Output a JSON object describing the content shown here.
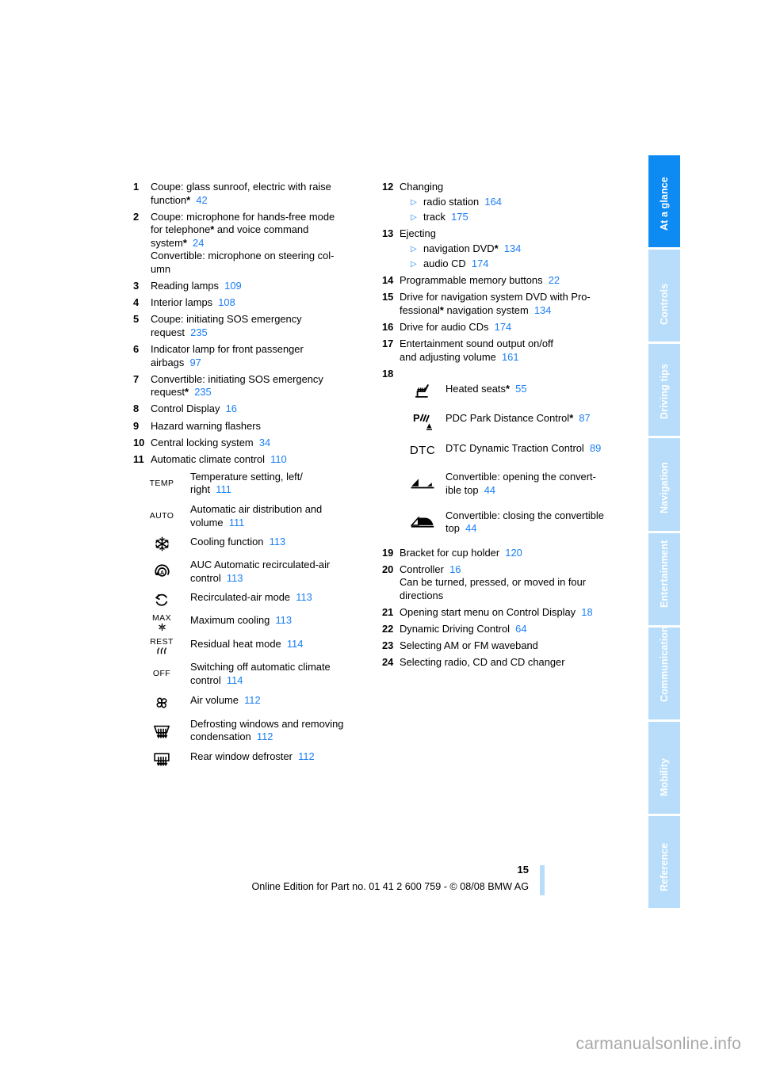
{
  "page": {
    "number": "15",
    "footer_text": "Online Edition for Part no. 01 41 2 600 759 - © 08/08 BMW AG",
    "watermark": "carmanualsonline.info"
  },
  "colors": {
    "reference_blue": "#1a7ef5",
    "tab_active": "#0d8bf2",
    "tab_inactive": "#b7ddfb",
    "watermark_gray": "#a8a8a8"
  },
  "sidebar": {
    "tabs": [
      {
        "label": "At a glance",
        "active": true
      },
      {
        "label": "Controls",
        "active": false
      },
      {
        "label": "Driving tips",
        "active": false
      },
      {
        "label": "Navigation",
        "active": false
      },
      {
        "label": "Entertainment",
        "active": false
      },
      {
        "label": "Communications",
        "active": false
      },
      {
        "label": "Mobility",
        "active": false
      },
      {
        "label": "Reference",
        "active": false
      }
    ]
  },
  "left_column": {
    "item1": {
      "num": "1",
      "line1": "Coupe: glass sunroof, electric with raise",
      "line2": "function",
      "star": "*",
      "ref": "42"
    },
    "item2": {
      "num": "2",
      "line1": "Coupe: microphone for hands-free mode",
      "line2a": "for telephone",
      "star1": "*",
      "line2b": " and voice command",
      "line3": "system",
      "star2": "*",
      "ref": "24",
      "line4": "Convertible: microphone on steering col-",
      "line5": "umn"
    },
    "item3": {
      "num": "3",
      "text": "Reading lamps",
      "ref": "109"
    },
    "item4": {
      "num": "4",
      "text": "Interior lamps",
      "ref": "108"
    },
    "item5": {
      "num": "5",
      "line1": "Coupe: initiating SOS emergency",
      "line2": "request",
      "ref": "235"
    },
    "item6": {
      "num": "6",
      "line1": "Indicator lamp for front passenger",
      "line2": "airbags",
      "ref": "97"
    },
    "item7": {
      "num": "7",
      "line1": "Convertible: initiating SOS emergency",
      "line2": "request",
      "star": "*",
      "ref": "235"
    },
    "item8": {
      "num": "8",
      "text": "Control Display",
      "ref": "16"
    },
    "item9": {
      "num": "9",
      "text": "Hazard warning flashers"
    },
    "item10": {
      "num": "10",
      "text": "Central locking system",
      "ref": "34"
    },
    "item11": {
      "num": "11",
      "text": "Automatic climate control",
      "ref": "110",
      "icon_rows": [
        {
          "icon": "temp-text-icon",
          "icon_label": "TEMP",
          "line1": "Temperature setting, left/",
          "line2": "right",
          "ref": "111"
        },
        {
          "icon": "auto-text-icon",
          "icon_label": "AUTO",
          "line1": "Automatic air distribution and",
          "line2": "volume",
          "ref": "111"
        },
        {
          "icon": "snowflake-icon",
          "line1": "Cooling function",
          "ref": "113"
        },
        {
          "icon": "auc-recirculation-icon",
          "line1": "AUC Automatic recirculated-air",
          "line2": "control",
          "ref": "113"
        },
        {
          "icon": "recirculated-air-icon",
          "line1": "Recirculated-air mode",
          "ref": "113"
        },
        {
          "icon": "max-cooling-icon",
          "icon_label": "MAX",
          "line1": "Maximum cooling",
          "ref": "113"
        },
        {
          "icon": "residual-heat-icon",
          "icon_label": "REST",
          "line1": "Residual heat mode",
          "ref": "114"
        },
        {
          "icon": "off-text-icon",
          "icon_label": "OFF",
          "line1": "Switching off automatic climate",
          "line2": "control",
          "ref": "114"
        },
        {
          "icon": "fan-air-volume-icon",
          "line1": "Air volume",
          "ref": "112"
        },
        {
          "icon": "windshield-defroster-icon",
          "line1": "Defrosting windows and removing",
          "line2": "condensation",
          "ref": "112"
        },
        {
          "icon": "rear-window-defroster-icon",
          "line1": "Rear window defroster",
          "ref": "112"
        }
      ]
    }
  },
  "right_column": {
    "item12": {
      "num": "12",
      "text": "Changing",
      "subs": [
        {
          "text": "radio station",
          "ref": "164"
        },
        {
          "text": "track",
          "ref": "175"
        }
      ]
    },
    "item13": {
      "num": "13",
      "text": "Ejecting",
      "subs": [
        {
          "text": "navigation DVD",
          "star": "*",
          "ref": "134"
        },
        {
          "text": "audio CD",
          "ref": "174"
        }
      ]
    },
    "item14": {
      "num": "14",
      "text": "Programmable memory buttons",
      "ref": "22"
    },
    "item15": {
      "num": "15",
      "line1": "Drive for navigation system DVD with Pro-",
      "line2a": "fessional",
      "star": "*",
      "line2b": " navigation system",
      "ref": "134"
    },
    "item16": {
      "num": "16",
      "text": "Drive for audio CDs",
      "ref": "174"
    },
    "item17": {
      "num": "17",
      "line1": "Entertainment sound output on/off",
      "line2": "and adjusting volume",
      "ref": "161"
    },
    "item18": {
      "num": "18",
      "icon_rows": [
        {
          "icon": "heated-seats-icon",
          "line1": "Heated seats",
          "star": "*",
          "ref": "55"
        },
        {
          "icon": "pdc-park-distance-icon",
          "line1": "PDC Park Distance Control",
          "star": "*",
          "ref": "87"
        },
        {
          "icon": "dtc-text-icon",
          "icon_label": "DTC",
          "line1": "DTC Dynamic Traction Control",
          "ref": "89"
        },
        {
          "icon": "convertible-top-open-icon",
          "line1": "Convertible: opening the convert-",
          "line2": "ible top",
          "ref": "44"
        },
        {
          "icon": "convertible-top-close-icon",
          "line1": "Convertible: closing the convertible",
          "line2": "top",
          "ref": "44"
        }
      ]
    },
    "item19": {
      "num": "19",
      "text": "Bracket for cup holder",
      "ref": "120"
    },
    "item20": {
      "num": "20",
      "text": "Controller",
      "ref": "16",
      "line2": "Can be turned, pressed, or moved in four",
      "line3": "directions"
    },
    "item21": {
      "num": "21",
      "text": "Opening start menu on Control Display",
      "ref": "18"
    },
    "item22": {
      "num": "22",
      "text": "Dynamic Driving Control",
      "ref": "64"
    },
    "item23": {
      "num": "23",
      "text": "Selecting AM or FM waveband"
    },
    "item24": {
      "num": "24",
      "text": "Selecting radio, CD and CD changer"
    }
  }
}
